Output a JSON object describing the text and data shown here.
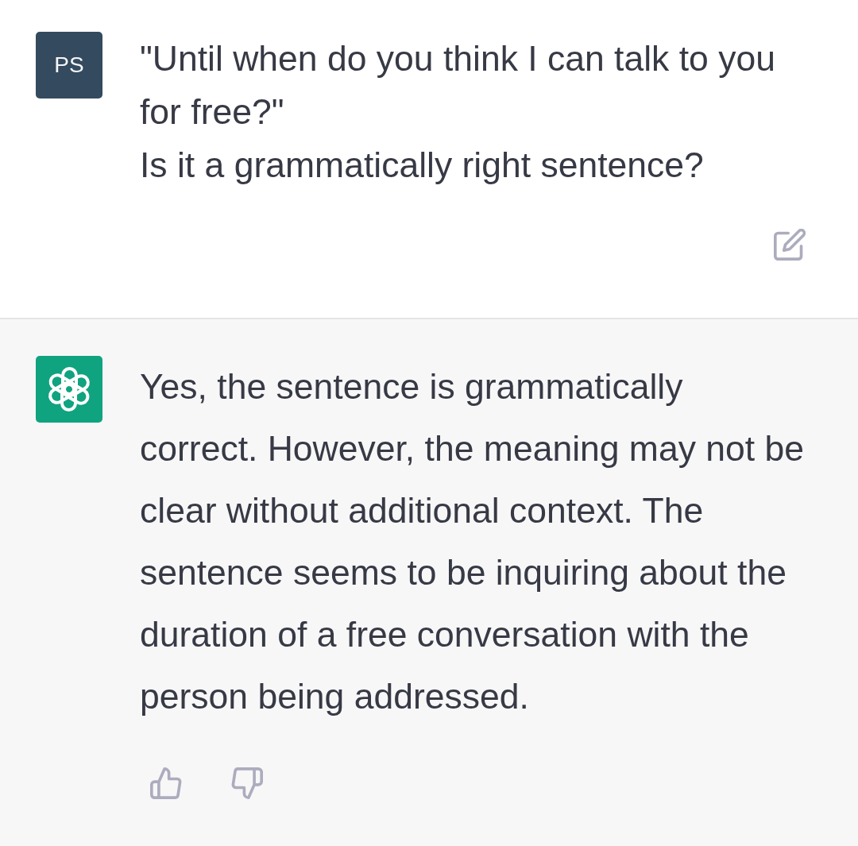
{
  "messages": [
    {
      "kind": "user",
      "avatar": "PS",
      "lines": [
        "\"Until when do you think I can talk to you for free?\"",
        "Is it a grammatically right sentence?"
      ]
    },
    {
      "kind": "assistant",
      "lines": [
        "Yes, the sentence is grammatically correct. However, the meaning may not be clear without additional context. The sentence seems to be inquiring about the duration of a free conversation with the person being addressed."
      ]
    }
  ]
}
